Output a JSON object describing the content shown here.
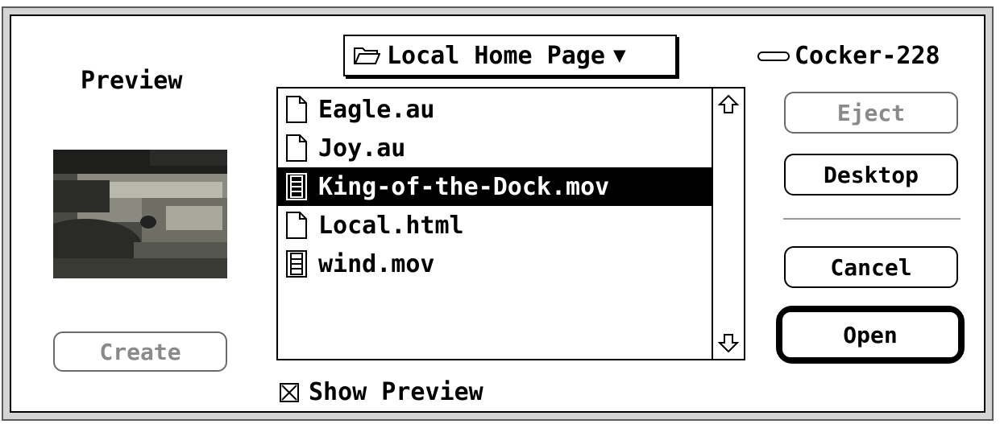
{
  "dialog": {
    "preview_label": "Preview",
    "create_label": "Create",
    "show_preview_label": "Show Preview",
    "show_preview_checked": true
  },
  "location": {
    "folder_popup": "Local Home Page",
    "volume_name": "Cocker-228"
  },
  "buttons": {
    "eject": "Eject",
    "desktop": "Desktop",
    "cancel": "Cancel",
    "open": "Open"
  },
  "file_list": [
    {
      "name": "Eagle.au",
      "icon": "document-icon",
      "selected": false
    },
    {
      "name": "Joy.au",
      "icon": "document-icon",
      "selected": false
    },
    {
      "name": "King-of-the-Dock.mov",
      "icon": "movie-icon",
      "selected": true
    },
    {
      "name": "Local.html",
      "icon": "document-icon",
      "selected": false
    },
    {
      "name": "wind.mov",
      "icon": "movie-icon",
      "selected": false
    }
  ],
  "colors": {
    "selection": "#000000",
    "disabled_text": "#8a8a8a",
    "frame": "#d4d4d4"
  }
}
